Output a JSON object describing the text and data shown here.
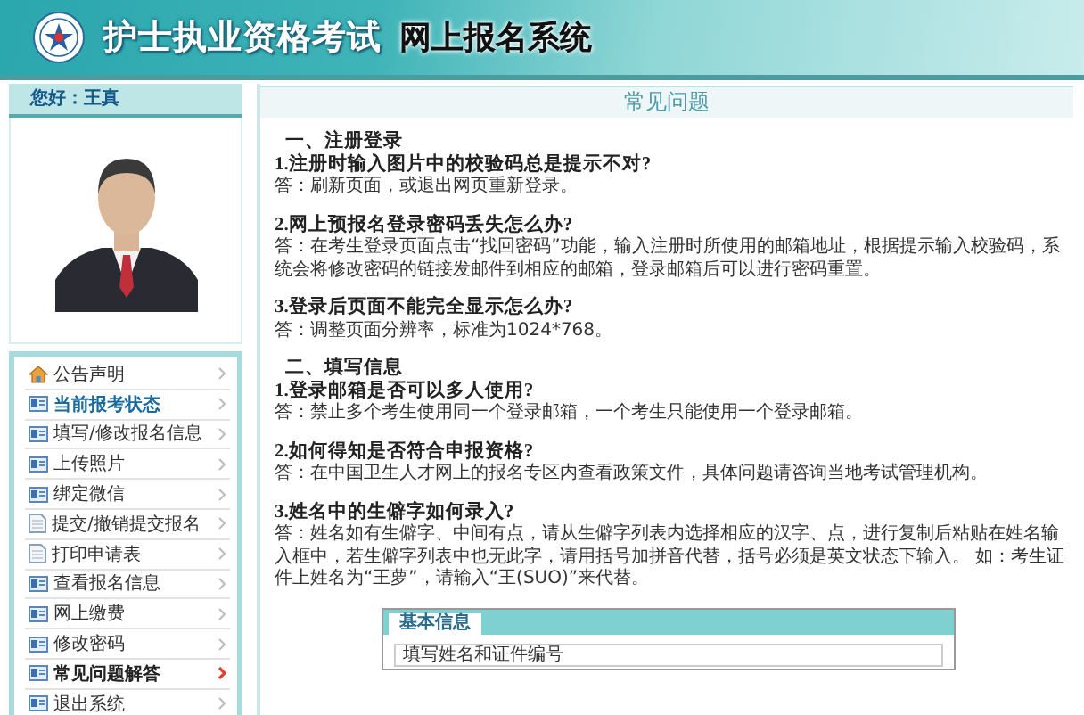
{
  "header": {
    "title": "护士执业资格考试",
    "subtitle": "网上报名系统"
  },
  "sidebar": {
    "greeting": "您好：王真",
    "menu": [
      {
        "label": "公告声明",
        "kind": "home",
        "selected": false,
        "emphasized": false
      },
      {
        "label": "当前报考状态",
        "kind": "card",
        "selected": false,
        "emphasized": true
      },
      {
        "label": "填写/修改报名信息",
        "kind": "card",
        "selected": false,
        "emphasized": false
      },
      {
        "label": "上传照片",
        "kind": "card",
        "selected": false,
        "emphasized": false
      },
      {
        "label": "绑定微信",
        "kind": "card",
        "selected": false,
        "emphasized": false
      },
      {
        "label": "提交/撤销提交报名",
        "kind": "doc",
        "selected": false,
        "emphasized": false
      },
      {
        "label": "打印申请表",
        "kind": "doc",
        "selected": false,
        "emphasized": false
      },
      {
        "label": "查看报名信息",
        "kind": "card",
        "selected": false,
        "emphasized": false
      },
      {
        "label": "网上缴费",
        "kind": "card",
        "selected": false,
        "emphasized": false
      },
      {
        "label": "修改密码",
        "kind": "card",
        "selected": false,
        "emphasized": false
      },
      {
        "label": "常见问题解答",
        "kind": "card",
        "selected": true,
        "emphasized": false
      },
      {
        "label": "退出系统",
        "kind": "card",
        "selected": false,
        "emphasized": false
      }
    ]
  },
  "main": {
    "title": "常见问题",
    "sections": [
      {
        "heading": "一、注册登录",
        "questions": [
          {
            "q": "1.注册时输入图片中的校验码总是提示不对?",
            "a": "答：刷新页面，或退出网页重新登录。"
          },
          {
            "q": "2.网上预报名登录密码丢失怎么办?",
            "a": "答：在考生登录页面点击“找回密码”功能，输入注册时所使用的邮箱地址，根据提示输入校验码，系统会将修改密码的链接发邮件到相应的邮箱，登录邮箱后可以进行密码重置。"
          },
          {
            "q": "3.登录后页面不能完全显示怎么办?",
            "a": "答：调整页面分辨率，标准为1024*768。"
          }
        ]
      },
      {
        "heading": "二、填写信息",
        "questions": [
          {
            "q": "1.登录邮箱是否可以多人使用?",
            "a": "答：禁止多个考生使用同一个登录邮箱，一个考生只能使用一个登录邮箱。"
          },
          {
            "q": "2.如何得知是否符合申报资格?",
            "a": "答：在中国卫生人才网上的报名专区内查看政策文件，具体问题请咨询当地考试管理机构。"
          },
          {
            "q": "3.姓名中的生僻字如何录入?",
            "a": "答：姓名如有生僻字、中间有点，请从生僻字列表内选择相应的汉字、点，进行复制后粘贴在姓名输入框中，若生僻字列表中也无此字，请用括号加拼音代替，括号必须是英文状态下输入。 如：考生证件上姓名为“王萝”，请输入“王(SUO)”来代替。"
          }
        ]
      }
    ],
    "example": {
      "tabs": [
        {
          "label": "基本信息",
          "selected": true
        }
      ],
      "field": "填写姓名和证件编号"
    }
  }
}
